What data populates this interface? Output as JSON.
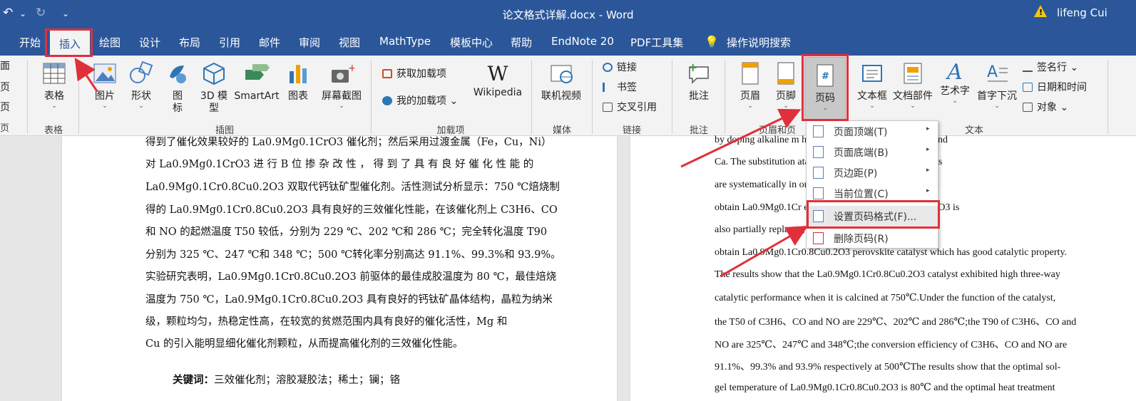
{
  "titlebar": {
    "title": "论文格式详解.docx  -  Word",
    "user": "lifeng Cui",
    "warn_glyph": "!"
  },
  "quickaccess": {
    "undo": "↶",
    "dropdown": "⌄",
    "redo": "↻",
    "customize": "⌄"
  },
  "tabs": [
    "开始",
    "插入",
    "绘图",
    "设计",
    "布局",
    "引用",
    "邮件",
    "审阅",
    "视图",
    "MathType",
    "模板中心",
    "帮助",
    "EndNote 20",
    "PDF工具集",
    "操作说明搜索"
  ],
  "ribbon": {
    "left_partial": [
      "面",
      "页",
      "页",
      "页"
    ],
    "table": "表格",
    "pictures": "图片",
    "shapes": "形状",
    "icons": [
      "图",
      "标"
    ],
    "models": [
      "3D 模",
      "型"
    ],
    "smartart": "SmartArt",
    "chart": "图表",
    "screenshot": "屏幕截图",
    "get_addins": "获取加载项",
    "my_addins": "我的加载项",
    "wikipedia": "Wikipedia",
    "wiki_w": "W",
    "online_video": "联机视频",
    "link": "链接",
    "bookmark": "书签",
    "crossref": "交叉引用",
    "comment": "批注",
    "header": "页眉",
    "footer": "页脚",
    "pagenum": "页码",
    "pagenum_glyph": "#",
    "textbox": "文本框",
    "quickparts": "文档部件",
    "wordart": "艺术字",
    "dropcap": "首字下沉",
    "signature": "签名行",
    "datetime": "日期和时间",
    "object": "对象",
    "groups": {
      "table": "表格",
      "illus": "插图",
      "addins": "加载项",
      "media": "媒体",
      "links": "链接",
      "comments": "批注",
      "hf": "页眉和页",
      "text": "文本",
      "partial": "页"
    }
  },
  "dropdown": [
    {
      "label": "页面顶端(T)",
      "arrow": "▸"
    },
    {
      "label": "页面底端(B)",
      "arrow": "▸"
    },
    {
      "label": "页边距(P)",
      "arrow": "▸"
    },
    {
      "label": "当前位置(C)",
      "arrow": "▸"
    },
    {
      "label": "设置页码格式(F)...",
      "arrow": ""
    },
    {
      "label": "删除页码(R)",
      "arrow": ""
    }
  ],
  "doc_left": [
    "得到了催化效果较好的 La0.9Mg0.1CrO3 催化剂；然后采用过渡金属（Fe，Cu，Ni）",
    "对  La0.9Mg0.1CrO3  进 行  B  位 掺 杂 改 性 ， 得 到 了 具 有 良 好 催 化 性 能 的",
    "La0.9Mg0.1Cr0.8Cu0.2O3 双取代钙钛矿型催化剂。活性测试分析显示：750 ℃焙烧制",
    "得的  La0.9Mg0.1Cr0.8Cu0.2O3 具有良好的三效催化性能，在该催化剂上 C3H6、CO",
    "和 NO 的起燃温度 T50 较低，分别为 229 ℃、202 ℃和 286 ℃；完全转化温度 T90",
    "分别为 325 ℃、247 ℃和 348 ℃；500 ℃转化率分别高达 91.1%、99.3%和 93.9%。",
    "实验研究表明，La0.9Mg0.1Cr0.8Cu0.2O3 前驱体的最佳成胶温度为 80 ℃，最佳焙烧",
    "温度为  750 ℃，La0.9Mg0.1Cr0.8Cu0.2O3 具有良好的钙钛矿晶体结构，晶粒为纳米",
    "级，颗粒均匀，热稳定性高，在较宽的贫燃范围内具有良好的催化活性，Mg 和",
    "Cu 的引入能明显细化催化剂颗粒，从而提高催化剂的三效催化性能。"
  ],
  "keywords": {
    "label": "关键词：",
    "text": "三效催化剂；溶胶凝胶法；稀土；镧；铬"
  },
  "doc_right": [
    "by doping alkaline m                            he alkali earth metal such as Mg and",
    "Ca. The substitution                              atalytic performance of the catalysts",
    "are systematically in                             on amounts are also optimized. We",
    "obtain La0.9Mg0.1Cr                              e B-site cations of La0.9Mg0.1CrO3 is",
    "also partially replac                              ts, such as Fe, Ni and Cu, and we",
    "obtain La0.9Mg0.1Cr0.8Cu0.2O3 perovskite catalyst which has good catalytic property.",
    "The results show that the La0.9Mg0.1Cr0.8Cu0.2O3 catalyst exhibited high three-way",
    "catalytic performance when it is calcined at 750℃.Under the function of the catalyst,",
    "the T50 of C3H6、CO and NO are 229℃、202℃ and 286℃;the T90 of C3H6、CO and",
    "NO are 325℃、247℃ and 348℃;the conversion efficiency of C3H6、CO and NO are",
    "91.1%、99.3% and 93.9% respectively at 500℃The results show that the optimal sol-",
    "gel temperature of La0.9Mg0.1Cr0.8Cu0.2O3 is 80℃ and the optimal heat treatment"
  ],
  "colors": {
    "ribbon_blue": "#2b579a",
    "highlight_red": "#e0303a"
  }
}
